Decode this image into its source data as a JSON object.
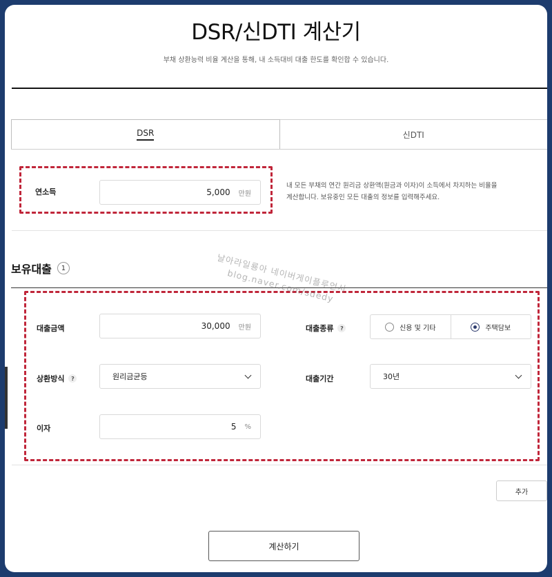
{
  "header": {
    "title": "DSR/신DTI 계산기",
    "subtitle": "부채 상환능력 비율 계산을 통해, 내 소득대비 대출 한도를 확인합 수 있습니다."
  },
  "tabs": [
    {
      "label": "DSR",
      "active": true
    },
    {
      "label": "신DTI",
      "active": false
    }
  ],
  "income": {
    "label": "연소득",
    "value": "5,000",
    "unit": "만원",
    "description_line1": "내 모든 부채의 연간 원리금 상환액(원금과 이자)이 소득에서 차지하는 비율을",
    "description_line2": "계산합니다. 보유중인 모든 대출의 정보를 입력해주세요."
  },
  "loans_section": {
    "title": "보유대출",
    "count": "1"
  },
  "loan": {
    "amount_label": "대출금액",
    "amount_value": "30,000",
    "amount_unit": "만원",
    "type_label": "대출종류",
    "type_options": [
      {
        "label": "신용 및 기타",
        "selected": false
      },
      {
        "label": "주택담보",
        "selected": true
      }
    ],
    "repay_label": "상환방식",
    "repay_value": "원리금균등",
    "period_label": "대출기간",
    "period_value": "30년",
    "rate_label": "이자",
    "rate_value": "5",
    "rate_unit": "%",
    "help_mark": "?"
  },
  "buttons": {
    "add": "추가",
    "calculate": "계산하기"
  },
  "watermark": {
    "line1": "날아라일룡아 네이버게이플루언서",
    "line2": "blog.naver.com/sdedy"
  },
  "colors": {
    "frame_bg": "#1d3c6e",
    "highlight": "#c0263a",
    "radio_accent": "#2e3c6e"
  }
}
